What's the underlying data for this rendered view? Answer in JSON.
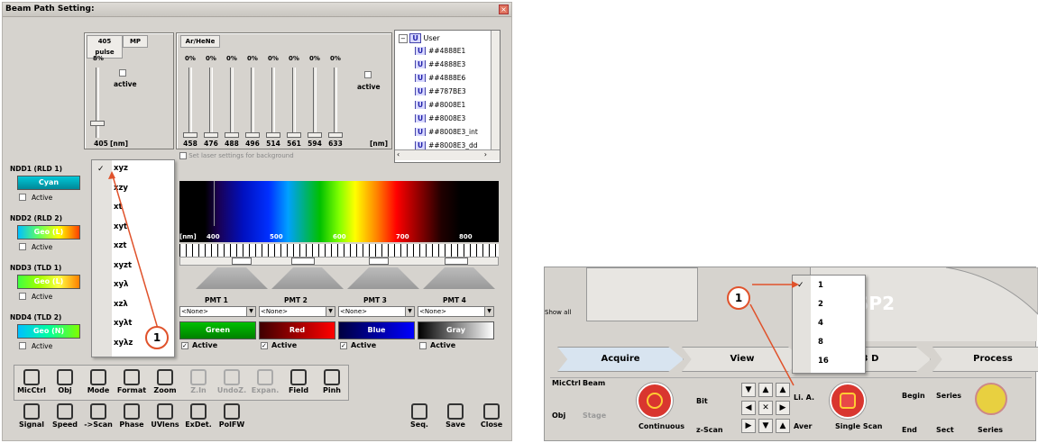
{
  "window": {
    "title": "Beam Path Setting:"
  },
  "uv_laser": {
    "tabs": [
      "405 pulse",
      "MP"
    ],
    "percent": "8%",
    "active_label": "active",
    "wavelength": "405",
    "unit": "[nm]"
  },
  "argon_laser": {
    "tab": "Ar/HeNe",
    "percents": [
      "0%",
      "0%",
      "0%",
      "0%",
      "0%",
      "0%",
      "0%",
      "0%"
    ],
    "active_label": "active",
    "wavelengths": [
      "458",
      "476",
      "488",
      "496",
      "514",
      "561",
      "594",
      "633"
    ],
    "unit": "[nm]"
  },
  "user_tree": {
    "root": "User",
    "items": [
      "##4888E1",
      "##4888E3",
      "##4888E6",
      "##787BE3",
      "##8008E1",
      "##8008E3",
      "##8008E3_int",
      "##8008E3_dd"
    ]
  },
  "background_checkbox": "Set laser settings for background",
  "detectors": [
    {
      "name": "NDD1 (RLD 1)",
      "color_label": "Cyan",
      "active": "Active"
    },
    {
      "name": "NDD2 (RLD 2)",
      "color_label": "Geo (L)",
      "active": "Active"
    },
    {
      "name": "NDD3 (TLD 1)",
      "color_label": "Geo (L)",
      "active": "Active"
    },
    {
      "name": "NDD4 (TLD 2)",
      "color_label": "Geo (N)",
      "active": "Active"
    }
  ],
  "spectrum": {
    "unit": "[nm]",
    "ticks": [
      "400",
      "500",
      "600",
      "700",
      "800"
    ]
  },
  "pmts": [
    {
      "name": "PMT 1",
      "select": "<None>",
      "color": "Green",
      "active": "Active",
      "checked": true
    },
    {
      "name": "PMT 2",
      "select": "<None>",
      "color": "Red",
      "active": "Active",
      "checked": true
    },
    {
      "name": "PMT 3",
      "select": "<None>",
      "color": "Blue",
      "active": "Active",
      "checked": true
    },
    {
      "name": "PMT 4",
      "select": "<None>",
      "color": "Gray",
      "active": "Active",
      "checked": false
    }
  ],
  "scan_mode_menu": {
    "items": [
      "xyz",
      "xzy",
      "xt",
      "xyt",
      "xzt",
      "xyzt",
      "xyλ",
      "xzλ",
      "xyλt",
      "xyλz"
    ],
    "selected": "xyz"
  },
  "callout_left": "1",
  "toolbar_row1": [
    "MicCtrl",
    "Obj",
    "Mode",
    "Format",
    "Zoom",
    "Z.In",
    "UndoZ.",
    "Expan.",
    "Field",
    "Pinh"
  ],
  "toolbar_row2": [
    "Signal",
    "Speed",
    "->Scan",
    "Phase",
    "UVlens",
    "ExDet.",
    "PolFW"
  ],
  "toolbar_right": [
    "Seq.",
    "Save",
    "Close"
  ],
  "right_panel": {
    "show_all": "Show all",
    "sp2_text": "SP2",
    "tabs": [
      "Acquire",
      "View",
      "3 D",
      "Process"
    ],
    "average_menu": {
      "items": [
        "1",
        "2",
        "4",
        "8",
        "16"
      ],
      "selected": "1"
    },
    "callout": "1",
    "buttons": [
      "MicCtrl",
      "Beam",
      "Obj",
      "Stage",
      "Continuous",
      "Bit",
      "z-Scan",
      "Li. A.",
      "Aver",
      "Single Scan",
      "Begin",
      "Series",
      "End",
      "Sect",
      "Series"
    ]
  }
}
